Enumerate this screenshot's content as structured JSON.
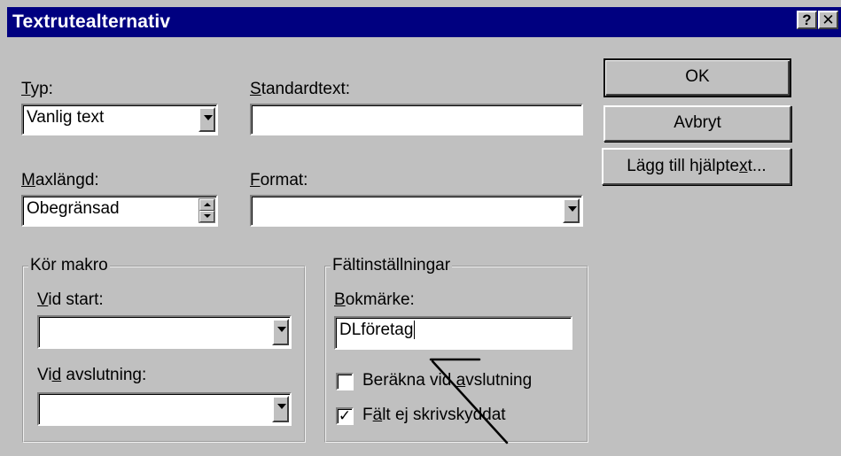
{
  "window": {
    "title": "Textrutealternativ",
    "help_glyph": "?",
    "close_glyph": "✕"
  },
  "fields": {
    "typ": {
      "label_u": "T",
      "label_rest": "yp:",
      "value": "Vanlig text"
    },
    "standardtext": {
      "label_u": "S",
      "label_rest": "tandardtext:",
      "value": ""
    },
    "maxlangd": {
      "label_u": "M",
      "label_rest": "axlängd:",
      "value": "Obegränsad"
    },
    "format": {
      "label_u": "F",
      "label_rest": "ormat:",
      "value": ""
    }
  },
  "buttons": {
    "ok": "OK",
    "avbryt": "Avbryt",
    "help_text_pre": "Lägg till hjälpte",
    "help_text_u": "x",
    "help_text_post": "t..."
  },
  "macro_group": {
    "legend": "Kör makro",
    "vid_start_u": "V",
    "vid_start_rest": "id start:",
    "vid_start_value": "",
    "vid_avslut_pre": "Vi",
    "vid_avslut_u": "d",
    "vid_avslut_post": " avslutning:",
    "vid_avslut_value": ""
  },
  "field_group": {
    "legend": "Fältinställningar",
    "bookmark_u": "B",
    "bookmark_rest": "okmärke:",
    "bookmark_value": "DLföretag",
    "calc_pre": "Beräkna vid ",
    "calc_u": "a",
    "calc_post": "vslutning",
    "calc_checked": false,
    "fill_pre": "F",
    "fill_u": "ä",
    "fill_post": "lt ej skrivskyddat",
    "fill_checked": true,
    "check_glyph": "✓"
  }
}
